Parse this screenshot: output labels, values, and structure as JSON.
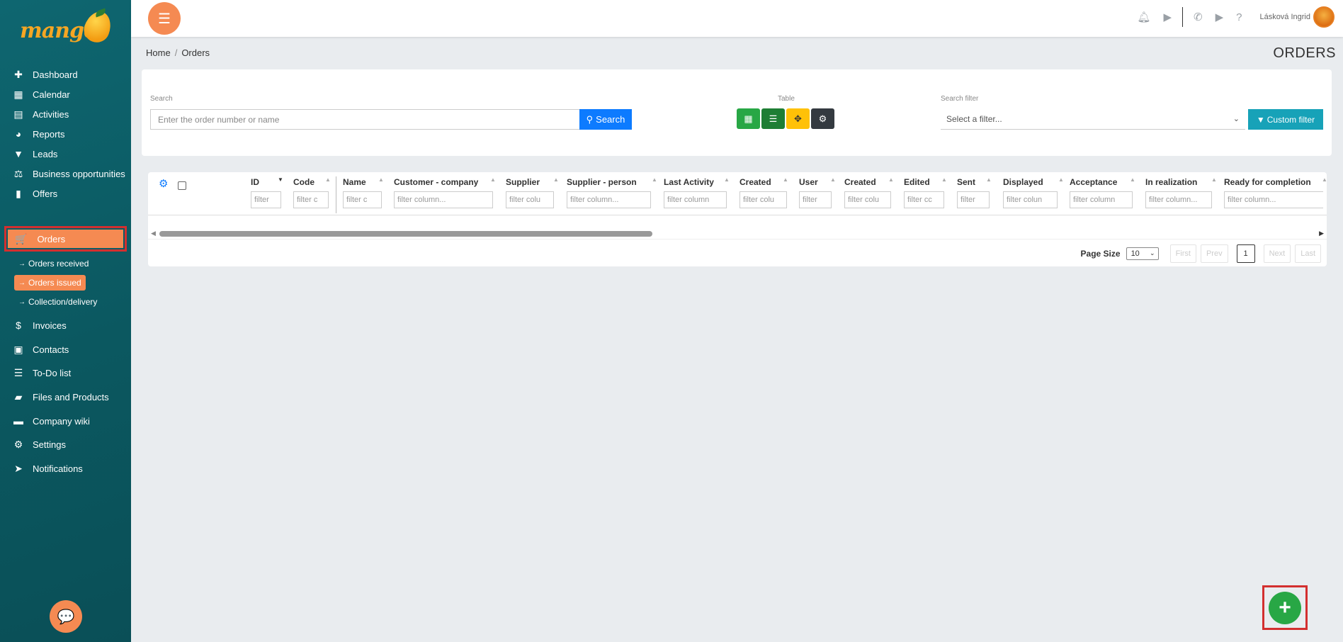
{
  "app": {
    "logo_text": "mango"
  },
  "sidebar": {
    "items": [
      {
        "label": "Dashboard",
        "icon": "puzzle-icon"
      },
      {
        "label": "Calendar",
        "icon": "calendar-icon"
      },
      {
        "label": "Activities",
        "icon": "activities-icon"
      },
      {
        "label": "Reports",
        "icon": "pie-chart-icon"
      },
      {
        "label": "Leads",
        "icon": "funnel-icon"
      },
      {
        "label": "Business opportunities",
        "icon": "scale-icon"
      },
      {
        "label": "Offers",
        "icon": "document-icon"
      },
      {
        "label": "Orders",
        "icon": "cart-icon"
      },
      {
        "label": "Invoices",
        "icon": "invoice-icon"
      },
      {
        "label": "Contacts",
        "icon": "contact-card-icon"
      },
      {
        "label": "To-Do list",
        "icon": "list-icon"
      },
      {
        "label": "Files and Products",
        "icon": "folder-icon"
      },
      {
        "label": "Company wiki",
        "icon": "book-icon"
      },
      {
        "label": "Settings",
        "icon": "gears-icon"
      },
      {
        "label": "Notifications",
        "icon": "paper-plane-icon"
      }
    ],
    "orders_sub": [
      {
        "label": "Orders received",
        "active": false
      },
      {
        "label": "Orders issued",
        "active": true
      },
      {
        "label": "Collection/delivery",
        "active": false
      }
    ]
  },
  "topbar": {
    "user_name": "Lásková Ingrid"
  },
  "breadcrumb": {
    "home": "Home",
    "divider": "/",
    "current": "Orders"
  },
  "page": {
    "title": "ORDERS"
  },
  "filters": {
    "search_label": "Search",
    "search_placeholder": "Enter the order number or name",
    "search_button": "Search",
    "table_label": "Table",
    "search_filter_label": "Search filter",
    "select_filter_value": "Select a filter...",
    "custom_filter_button": "Custom filter"
  },
  "table": {
    "columns": [
      {
        "header": "ID",
        "filter": "filter"
      },
      {
        "header": "Code",
        "filter": "filter c"
      },
      {
        "header": "Name",
        "filter": "filter c"
      },
      {
        "header": "Customer - company",
        "filter": "filter column..."
      },
      {
        "header": "Supplier",
        "filter": "filter colu"
      },
      {
        "header": "Supplier - person",
        "filter": "filter column..."
      },
      {
        "header": "Last Activity",
        "filter": "filter column"
      },
      {
        "header": "Created",
        "filter": "filter colu"
      },
      {
        "header": "User",
        "filter": "filter"
      },
      {
        "header": "Created",
        "filter": "filter colu"
      },
      {
        "header": "Edited",
        "filter": "filter cc"
      },
      {
        "header": "Sent",
        "filter": "filter"
      },
      {
        "header": "Displayed",
        "filter": "filter colun"
      },
      {
        "header": "Acceptance",
        "filter": "filter column"
      },
      {
        "header": "In realization",
        "filter": "filter column..."
      },
      {
        "header": "Ready for completion",
        "filter": "filter column..."
      }
    ]
  },
  "pager": {
    "page_size_label": "Page Size",
    "page_size_value": "10",
    "first": "First",
    "prev": "Prev",
    "current": "1",
    "next": "Next",
    "last": "Last"
  },
  "fab": {
    "label": "+"
  },
  "colors": {
    "accent": "#f58a52",
    "sidebar": "#0b5860",
    "primary": "#0d7bff",
    "success": "#28a745",
    "info": "#17a2b8",
    "highlight": "#d32f2f"
  }
}
